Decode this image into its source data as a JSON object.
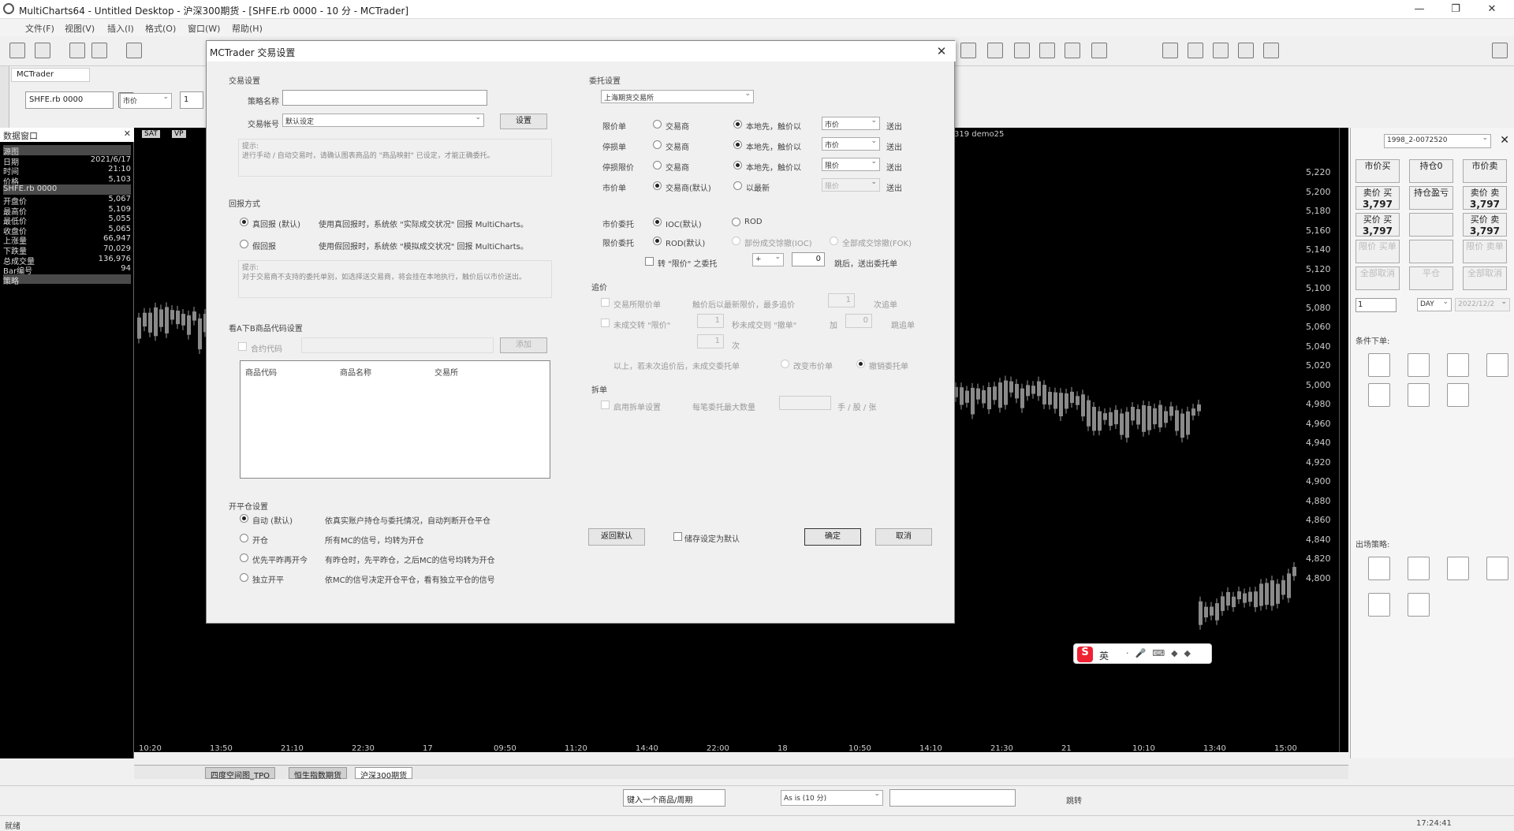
{
  "window": {
    "title": "MultiCharts64 - Untitled Desktop - 沪深300期货 - [SHFE.rb 0000 - 10 分 - MCTrader]"
  },
  "menu": [
    "文件(F)",
    "视图(V)",
    "插入(I)",
    "格式(O)",
    "窗口(W)",
    "帮助(H)"
  ],
  "doc_tab": "MCTrader",
  "symbol": {
    "value": "SHFE.rb 0000",
    "order_type": "市价",
    "qty": "1"
  },
  "data_window": {
    "title": "数据窗口",
    "rows": [
      {
        "label": "源图",
        "value": "",
        "hl": true
      },
      {
        "label": "日期",
        "value": "2021/6/17"
      },
      {
        "label": "时间",
        "value": "21:10"
      },
      {
        "label": "价格",
        "value": "5,103"
      },
      {
        "label": "SHFE.rb 0000",
        "value": "",
        "hl": true
      },
      {
        "label": "开盘价",
        "value": "5,067"
      },
      {
        "label": "最高价",
        "value": "5,109"
      },
      {
        "label": "最低价",
        "value": "5,055"
      },
      {
        "label": "收盘价",
        "value": "5,065"
      },
      {
        "label": "上涨量",
        "value": "66,947"
      },
      {
        "label": "下跌量",
        "value": "70,029"
      },
      {
        "label": "总成交量",
        "value": "136,976"
      },
      {
        "label": "Bar编号",
        "value": "94"
      },
      {
        "label": "策略",
        "value": "",
        "hl": true
      }
    ]
  },
  "chart": {
    "header_right": "319 demo25",
    "tags": [
      "SAT",
      "VP"
    ],
    "price_ticks": [
      "5,220",
      "5,200",
      "5,180",
      "5,160",
      "5,140",
      "5,120",
      "5,100",
      "5,080",
      "5,060",
      "5,040",
      "5,020",
      "5,000",
      "4,980",
      "4,960",
      "4,940",
      "4,920",
      "4,900",
      "4,880",
      "4,860",
      "4,840",
      "4,820",
      "4,800"
    ],
    "time_ticks": [
      "10:20",
      "13:50",
      "21:10",
      "22:30",
      "17",
      "09:50",
      "11:20",
      "14:40",
      "22:00",
      "18",
      "10:50",
      "14:10",
      "21:30",
      "21",
      "10:10",
      "13:40",
      "15:00"
    ]
  },
  "bottom_tabs": [
    "四度空间图_TPO",
    "恒生指数期货",
    "沪深300期货"
  ],
  "bottom_toolbar": {
    "symbol_input": "键入一个商品/周期",
    "as_is": "As is (10 分)",
    "jump": "跳转"
  },
  "status": {
    "left": "就绪",
    "time": "17:24:41"
  },
  "right_panel": {
    "account": "1998_2-0072520",
    "buttons": [
      {
        "label": "市价买",
        "val": ""
      },
      {
        "label": "持仓0",
        "val": ""
      },
      {
        "label": "市价卖",
        "val": ""
      },
      {
        "label": "卖价 买",
        "val": "3,797"
      },
      {
        "label": "持仓盈亏",
        "val": ""
      },
      {
        "label": "卖价 卖",
        "val": "3,797"
      },
      {
        "label": "买价 买",
        "val": "3,797"
      },
      {
        "label": "",
        "val": ""
      },
      {
        "label": "买价 卖",
        "val": "3,797"
      },
      {
        "label": "限价 买单",
        "val": ""
      },
      {
        "label": "",
        "val": ""
      },
      {
        "label": "限价 卖单",
        "val": ""
      },
      {
        "label": "全部取消",
        "val": ""
      },
      {
        "label": "平仓",
        "val": ""
      },
      {
        "label": "全部取消",
        "val": ""
      }
    ],
    "qty": "1",
    "tif": "DAY",
    "date": "2022/12/2",
    "cond_title": "条件下单:",
    "exit_title": "出场策略:"
  },
  "dialog": {
    "title": "MCTrader 交易设置",
    "trade_group": "交易设置",
    "strategy_name_label": "策略名称",
    "strategy_name_value": "",
    "account_label": "交易帐号",
    "account_value": "默认设定",
    "settings_btn": "设置",
    "hint1": "提示:\n进行手动 / 自动交易时，请确认图表商品的 \"商品映射\" 已设定，才能正确委托。",
    "report_group": "回报方式",
    "real_report": "真回报 (默认)",
    "real_report_desc": "使用真回报时，系统依 \"实际成交状况\" 回报 MultiCharts。",
    "fake_report": "假回报",
    "fake_report_desc": "使用假回报时，系统依 \"模拟成交状况\" 回报 MultiCharts。",
    "hint2": "提示:\n对于交易商不支持的委托单别，如选择送交易商，将会挂在本地执行，触价后以市价送出。",
    "map_group": "看A下B商品代码设置",
    "contract_code": "合约代码",
    "add_btn": "添加",
    "tbl_cols": [
      "商品代码",
      "商品名称",
      "交易所"
    ],
    "open_close_group": "开平仓设置",
    "oc_options": [
      {
        "label": "自动 (默认)",
        "desc": "依真实账户持仓与委托情况，自动判断开仓平仓"
      },
      {
        "label": "开仓",
        "desc": "所有MC的信号，均转为开仓"
      },
      {
        "label": "优先平昨再开今",
        "desc": "有昨仓时，先平昨仓，之后MC的信号均转为开仓"
      },
      {
        "label": "独立开平",
        "desc": "依MC的信号决定开仓平仓，看有独立平仓的信号"
      }
    ],
    "order_group": "委托设置",
    "exchange": "上海期货交易所",
    "order_rows": [
      {
        "label": "限价单",
        "send": "交易商",
        "local": "本地先，触价以",
        "type": "市价",
        "out": "送出"
      },
      {
        "label": "停损单",
        "send": "交易商",
        "local": "本地先，触价以",
        "type": "市价",
        "out": "送出"
      },
      {
        "label": "停损限价",
        "send": "交易商",
        "local": "本地先，触价以",
        "type": "限价",
        "out": "送出"
      },
      {
        "label": "市价单",
        "send": "交易商(默认)",
        "local": "以最新",
        "type": "限价",
        "out": "送出"
      }
    ],
    "mkt_order_label": "市价委托",
    "mkt_ioc": "IOC(默认)",
    "mkt_rod": "ROD",
    "lmt_order_label": "限价委托",
    "lmt_rod": "ROD(默认)",
    "lmt_ioc": "部份成交馀撤(IOC)",
    "lmt_fok": "全部成交馀撤(FOK)",
    "convert_label": "转 \"限价\" 之委托",
    "convert_sign": "+",
    "convert_val": "0",
    "convert_tail": "跳后，送出委托单",
    "chase_group": "追价",
    "chase_row1a": "交易所限价单",
    "chase_row1b": "触价后以最新限价，最多追价",
    "chase_row1c": "1",
    "chase_row1d": "次追单",
    "chase_row2a": "未成交转 \"限价\"",
    "chase_row2b": "1",
    "chase_row2c": "秒未成交则 \"撤单\"",
    "chase_row2d": "加",
    "chase_row2e": "0",
    "chase_row2f": "跳追单",
    "chase_row3": "1",
    "chase_row3b": "次",
    "chase_row4a": "以上，若未次追价后，未成交委托单",
    "chase_row4b": "改变市价单",
    "chase_row4c": "撤销委托单",
    "split_group": "拆单",
    "split_chk": "启用拆单设置",
    "split_desc": "每笔委托最大数量",
    "split_unit": "手 / 股 / 张",
    "restore_btn": "返回默认",
    "save_default": "储存设定为默认",
    "ok_btn": "确定",
    "cancel_btn": "取消"
  },
  "ime": {
    "label": "英"
  }
}
